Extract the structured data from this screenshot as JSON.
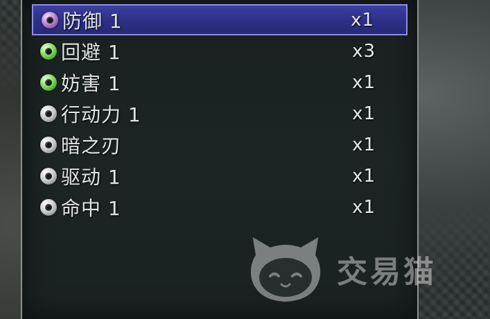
{
  "colors": {
    "selection": "#2d2f86",
    "selection_border": "#8c8ee0",
    "text": "#e0e4e4"
  },
  "items": [
    {
      "name": "防御 1",
      "qty": "x1",
      "orb": "purple",
      "icon": "purple-orb-icon",
      "selected": true
    },
    {
      "name": "回避 1",
      "qty": "x3",
      "orb": "green",
      "icon": "green-orb-icon",
      "selected": false
    },
    {
      "name": "妨害 1",
      "qty": "x1",
      "orb": "green",
      "icon": "green-orb-icon",
      "selected": false
    },
    {
      "name": "行动力 1",
      "qty": "x1",
      "orb": "white",
      "icon": "white-orb-icon",
      "selected": false
    },
    {
      "name": "暗之刃",
      "qty": "x1",
      "orb": "white",
      "icon": "white-orb-icon",
      "selected": false
    },
    {
      "name": "驱动 1",
      "qty": "x1",
      "orb": "white",
      "icon": "white-orb-icon",
      "selected": false
    },
    {
      "name": "命中 1",
      "qty": "x1",
      "orb": "white",
      "icon": "white-orb-icon",
      "selected": false
    }
  ],
  "watermark": {
    "text": "交易猫",
    "icon": "cat-logo-icon"
  }
}
